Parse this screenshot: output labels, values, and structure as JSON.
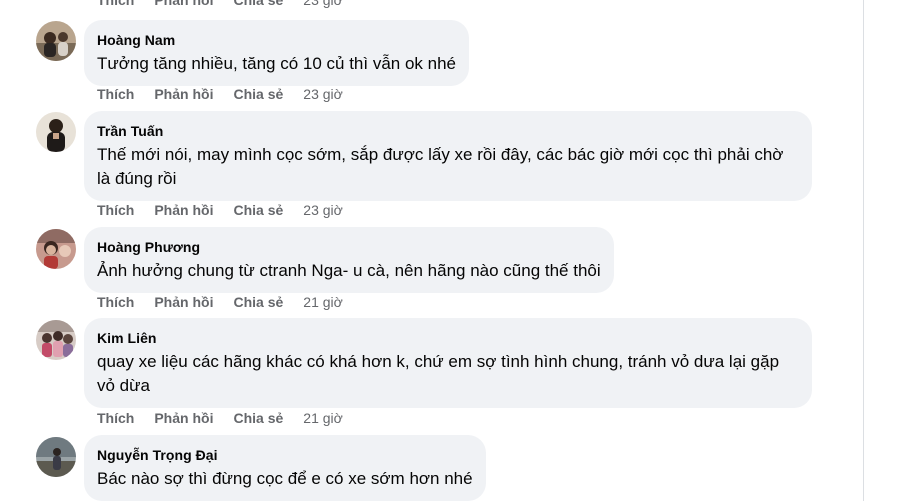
{
  "labels": {
    "like": "Thích",
    "reply": "Phản hồi",
    "share": "Chia sẻ"
  },
  "top_actions": {
    "time": "23 giờ"
  },
  "comments": [
    {
      "author": "Hoàng Nam",
      "text": "Tưởng tăng nhiều, tăng có 10 củ thì vẫn ok nhé",
      "time": "23 giờ"
    },
    {
      "author": "Trần Tuấn",
      "text": "Thế mới nói, may mình cọc sớm, sắp được lấy xe rồi đây, các bác giờ mới cọc thì phải chờ là đúng rồi",
      "time": "23 giờ"
    },
    {
      "author": "Hoàng Phương",
      "text": "Ảnh hưởng chung từ ctranh Nga- u cà, nên hãng nào cũng thế thôi",
      "time": "21 giờ"
    },
    {
      "author": "Kim Liên",
      "text": "quay xe liệu các hãng khác có khá hơn k, chứ em sợ tình hình chung, tránh vỏ dưa lại gặp vỏ dừa",
      "time": "21 giờ"
    },
    {
      "author": "Nguyễn Trọng Đại",
      "text": "Bác nào sợ thì đừng cọc để e có xe sớm hơn nhé"
    }
  ]
}
